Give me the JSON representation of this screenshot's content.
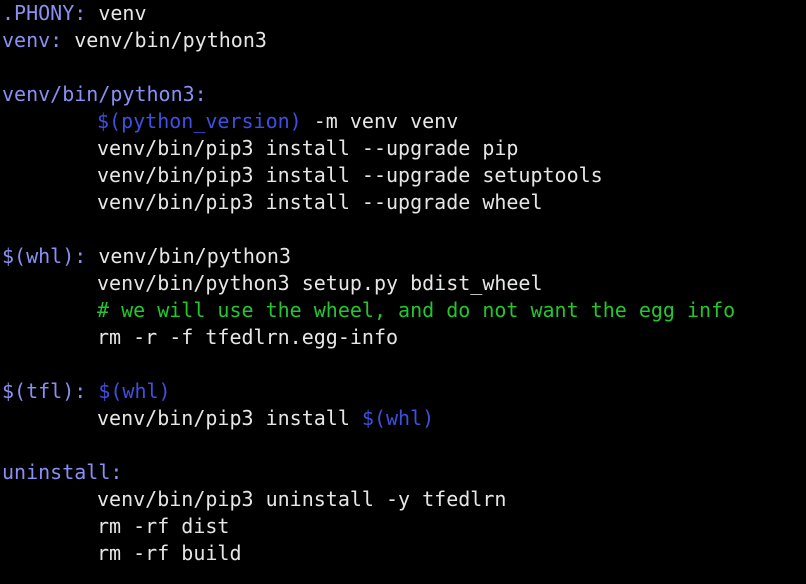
{
  "colors": {
    "background": "#000000",
    "text": "#e6e6e6",
    "target": "#8a90f2",
    "variable": "#3f4fe0",
    "comment": "#22c72e"
  },
  "lines": [
    {
      "segments": [
        {
          "type": "target",
          "text": ".PHONY:"
        },
        {
          "type": "text",
          "text": " venv"
        }
      ]
    },
    {
      "segments": [
        {
          "type": "target",
          "text": "venv:"
        },
        {
          "type": "text",
          "text": " venv/bin/python3"
        }
      ]
    },
    {
      "segments": []
    },
    {
      "segments": [
        {
          "type": "target",
          "text": "venv/bin/python3:"
        }
      ]
    },
    {
      "indent": true,
      "segments": [
        {
          "type": "var",
          "text": "$(python_version)"
        },
        {
          "type": "text",
          "text": " -m venv venv"
        }
      ]
    },
    {
      "indent": true,
      "segments": [
        {
          "type": "text",
          "text": "venv/bin/pip3 install --upgrade pip"
        }
      ]
    },
    {
      "indent": true,
      "segments": [
        {
          "type": "text",
          "text": "venv/bin/pip3 install --upgrade setuptools"
        }
      ]
    },
    {
      "indent": true,
      "segments": [
        {
          "type": "text",
          "text": "venv/bin/pip3 install --upgrade wheel"
        }
      ]
    },
    {
      "segments": []
    },
    {
      "segments": [
        {
          "type": "target",
          "text": "$(whl):"
        },
        {
          "type": "text",
          "text": " venv/bin/python3"
        }
      ]
    },
    {
      "indent": true,
      "segments": [
        {
          "type": "text",
          "text": "venv/bin/python3 setup.py bdist_wheel"
        }
      ]
    },
    {
      "indent": true,
      "segments": [
        {
          "type": "comment",
          "text": "# we will use the wheel, and do not want the egg info"
        }
      ]
    },
    {
      "indent": true,
      "segments": [
        {
          "type": "text",
          "text": "rm -r -f tfedlrn.egg-info"
        }
      ]
    },
    {
      "segments": []
    },
    {
      "segments": [
        {
          "type": "target",
          "text": "$(tfl):"
        },
        {
          "type": "text",
          "text": " "
        },
        {
          "type": "var",
          "text": "$(whl)"
        }
      ]
    },
    {
      "indent": true,
      "segments": [
        {
          "type": "text",
          "text": "venv/bin/pip3 install "
        },
        {
          "type": "var",
          "text": "$(whl)"
        }
      ]
    },
    {
      "segments": []
    },
    {
      "segments": [
        {
          "type": "target",
          "text": "uninstall:"
        }
      ]
    },
    {
      "indent": true,
      "segments": [
        {
          "type": "text",
          "text": "venv/bin/pip3 uninstall -y tfedlrn"
        }
      ]
    },
    {
      "indent": true,
      "segments": [
        {
          "type": "text",
          "text": "rm -rf dist"
        }
      ]
    },
    {
      "indent": true,
      "segments": [
        {
          "type": "text",
          "text": "rm -rf build"
        }
      ]
    }
  ]
}
